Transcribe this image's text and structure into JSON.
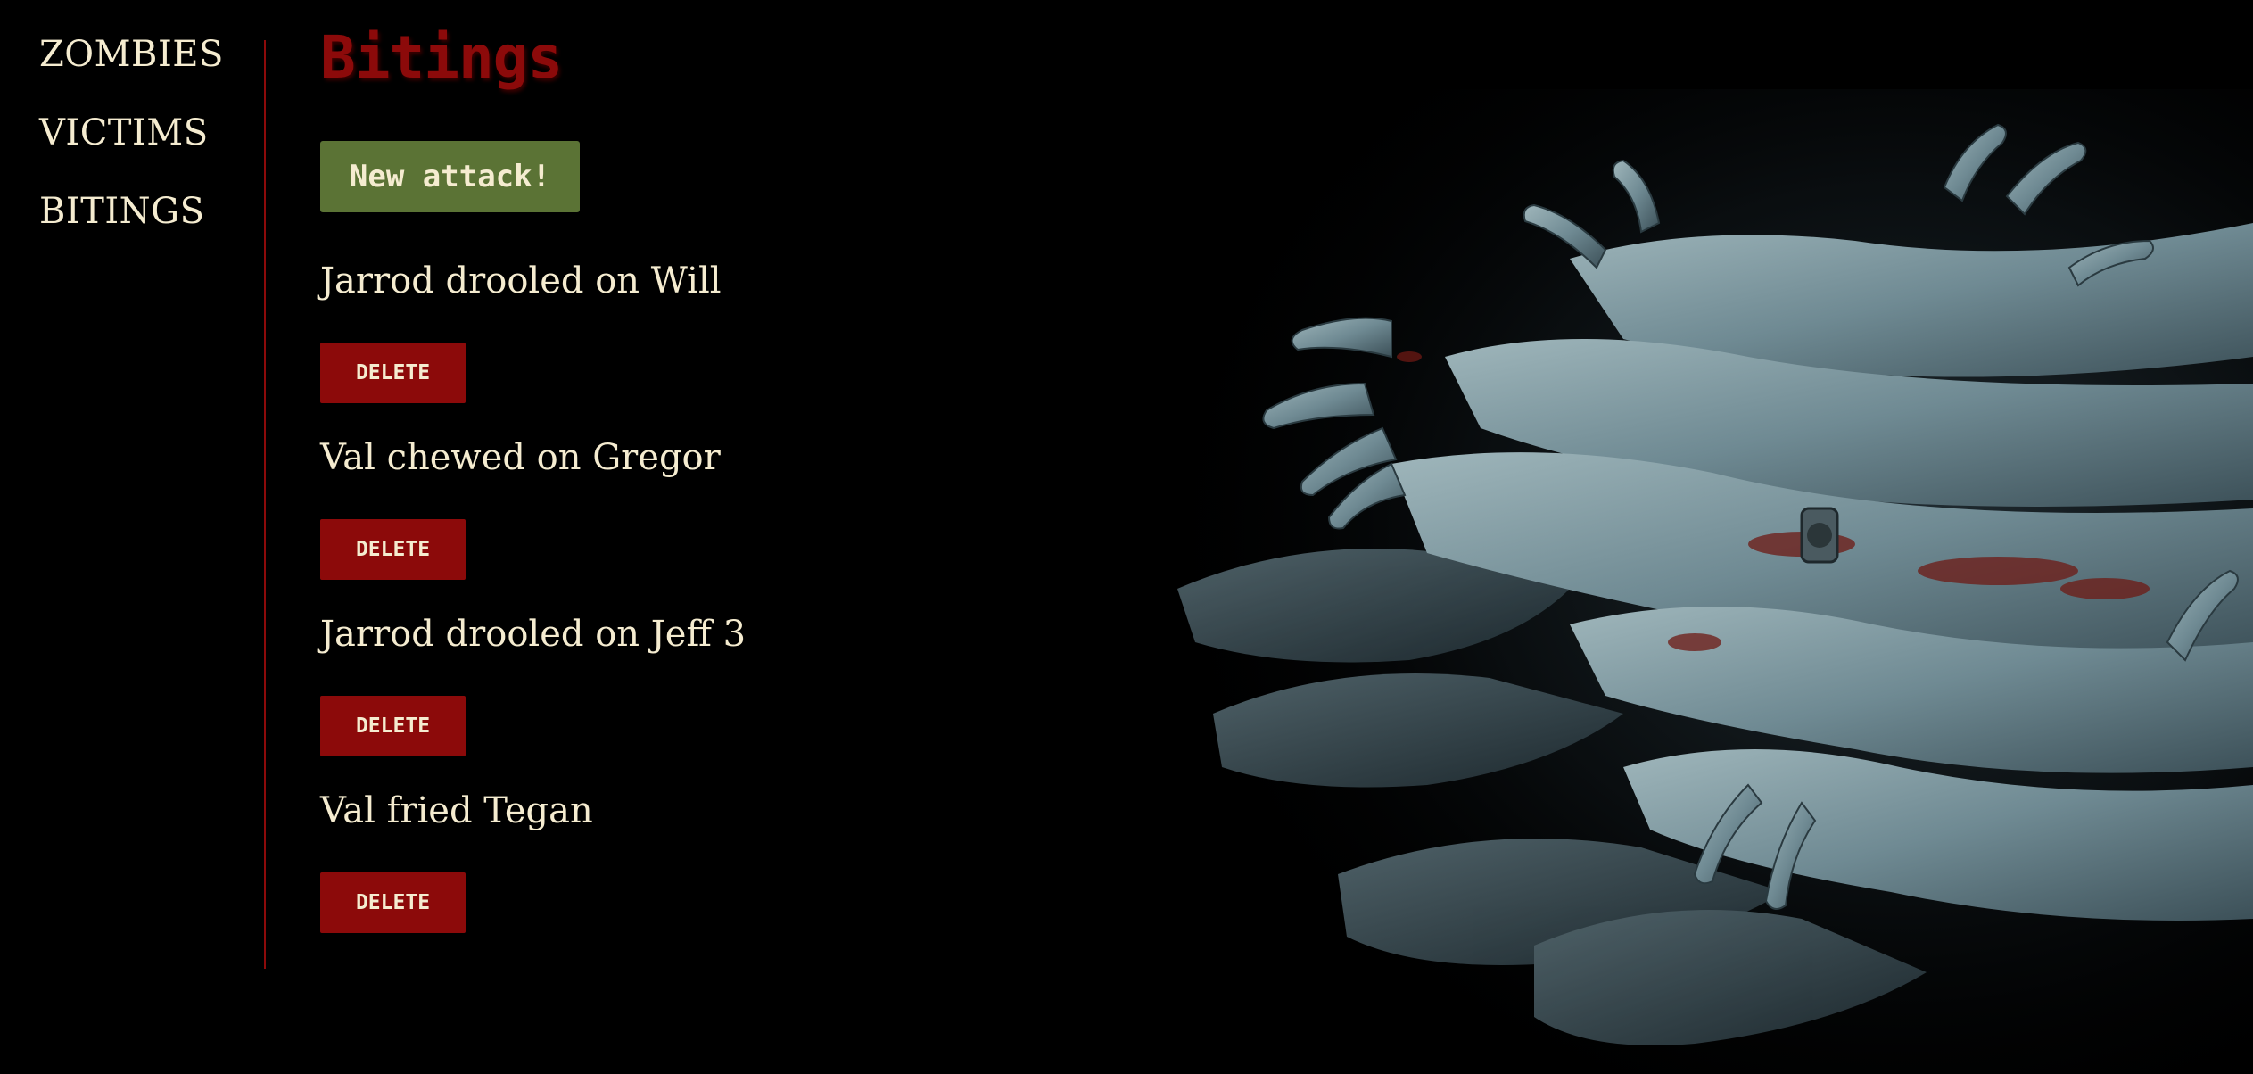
{
  "nav": {
    "items": [
      {
        "label": "ZOMBIES"
      },
      {
        "label": "VICTIMS"
      },
      {
        "label": "BITINGS"
      }
    ]
  },
  "page": {
    "title": "Bitings",
    "new_attack_label": "New attack!"
  },
  "bitings": [
    {
      "text": "Jarrod drooled on Will",
      "delete_label": "DELETE"
    },
    {
      "text": "Val chewed on Gregor",
      "delete_label": "DELETE"
    },
    {
      "text": "Jarrod drooled on Jeff 3",
      "delete_label": "DELETE"
    },
    {
      "text": "Val fried Tegan",
      "delete_label": "DELETE"
    }
  ],
  "colors": {
    "background": "#000000",
    "text": "#f5ecd0",
    "blood_red": "#8c0a0a",
    "button_green": "#5b7335",
    "zombie_skin": "#7f9aa2"
  },
  "decorations": {
    "hero_image": "zombie-hands-illustration"
  }
}
